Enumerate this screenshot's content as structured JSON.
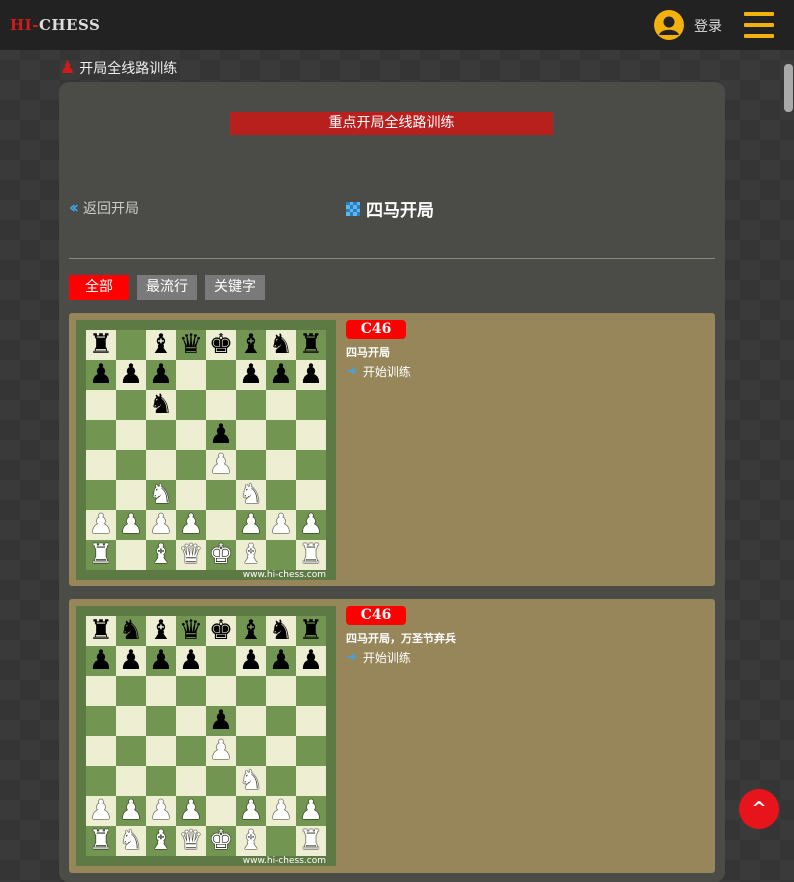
{
  "header": {
    "logo_hi": "HI",
    "logo_dash": "-",
    "logo_chess": "CHESS",
    "login_label": "登录",
    "avatar_icon": "user-circle-icon",
    "menu_icon": "hamburger-menu-icon"
  },
  "breadcrumb": {
    "icon": "chess-pawns-icon",
    "label": "开局全线路训练"
  },
  "panel": {
    "banner_label": "重点开局全线路训练",
    "back_label": "返回开局",
    "back_icon": "double-chevron-left-icon",
    "title": "四马开局",
    "title_icon": "checkered-grid-icon"
  },
  "filters": [
    {
      "label": "全部",
      "active": true
    },
    {
      "label": "最流行",
      "active": false
    },
    {
      "label": "关键字",
      "active": false
    }
  ],
  "openings": [
    {
      "eco": "C46",
      "name": "四马开局",
      "action_label": "开始训练",
      "watermark": "www.hi-chess.com",
      "position": [
        "r.bqkbnr",
        "ppp..ppp",
        "..n.....",
        "....p...",
        "....P...",
        "..N..N..",
        "PPPP.PPP",
        "R.BQKB.R"
      ]
    },
    {
      "eco": "C46",
      "name": "四马开局，万圣节弃兵",
      "action_label": "开始训练",
      "watermark": "www.hi-chess.com",
      "position": [
        "rnbqkbnr",
        "pppp.ppp",
        "........",
        "....p...",
        "....P...",
        ".....N..",
        "PPPP.PPP",
        "RNBQKB.R"
      ]
    }
  ],
  "colors": {
    "accent_red": "#ff0000",
    "banner_red": "#b8201e",
    "gold": "#f2b10c",
    "card_bg": "#968659",
    "board_light": "#eeeed2",
    "board_dark": "#739552"
  },
  "scroll_top_icon": "chevron-up-icon"
}
